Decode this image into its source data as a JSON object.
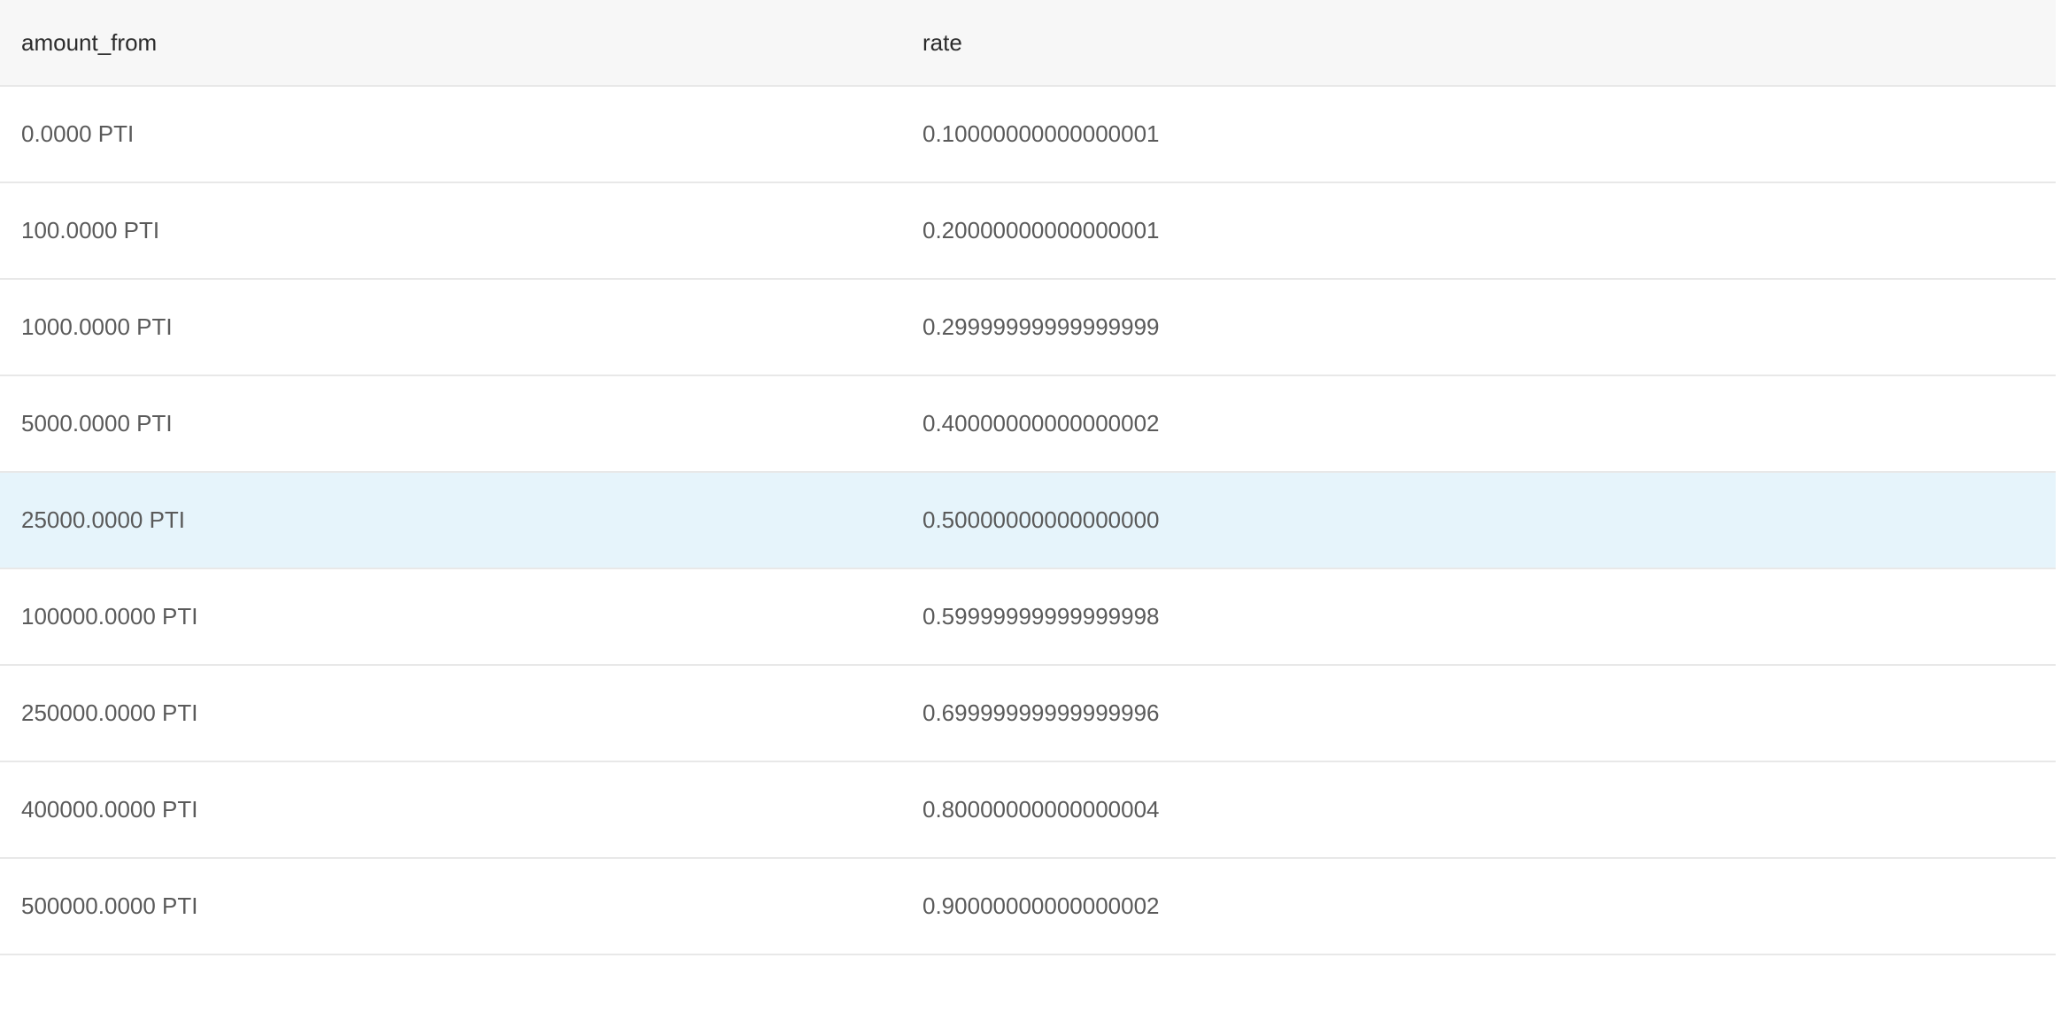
{
  "table": {
    "columns": [
      "amount_from",
      "rate"
    ],
    "rows": [
      {
        "amount_from": "0.0000 PTI",
        "rate": "0.10000000000000001",
        "highlighted": false
      },
      {
        "amount_from": "100.0000 PTI",
        "rate": "0.20000000000000001",
        "highlighted": false
      },
      {
        "amount_from": "1000.0000 PTI",
        "rate": "0.29999999999999999",
        "highlighted": false
      },
      {
        "amount_from": "5000.0000 PTI",
        "rate": "0.40000000000000002",
        "highlighted": false
      },
      {
        "amount_from": "25000.0000 PTI",
        "rate": "0.50000000000000000",
        "highlighted": true
      },
      {
        "amount_from": "100000.0000 PTI",
        "rate": "0.59999999999999998",
        "highlighted": false
      },
      {
        "amount_from": "250000.0000 PTI",
        "rate": "0.69999999999999996",
        "highlighted": false
      },
      {
        "amount_from": "400000.0000 PTI",
        "rate": "0.80000000000000004",
        "highlighted": false
      },
      {
        "amount_from": "500000.0000 PTI",
        "rate": "0.90000000000000002",
        "highlighted": false
      }
    ]
  },
  "colors": {
    "header_bg": "#f7f7f7",
    "highlight_row_bg": "#e6f4fb",
    "row_border": "#e8e8e8"
  }
}
